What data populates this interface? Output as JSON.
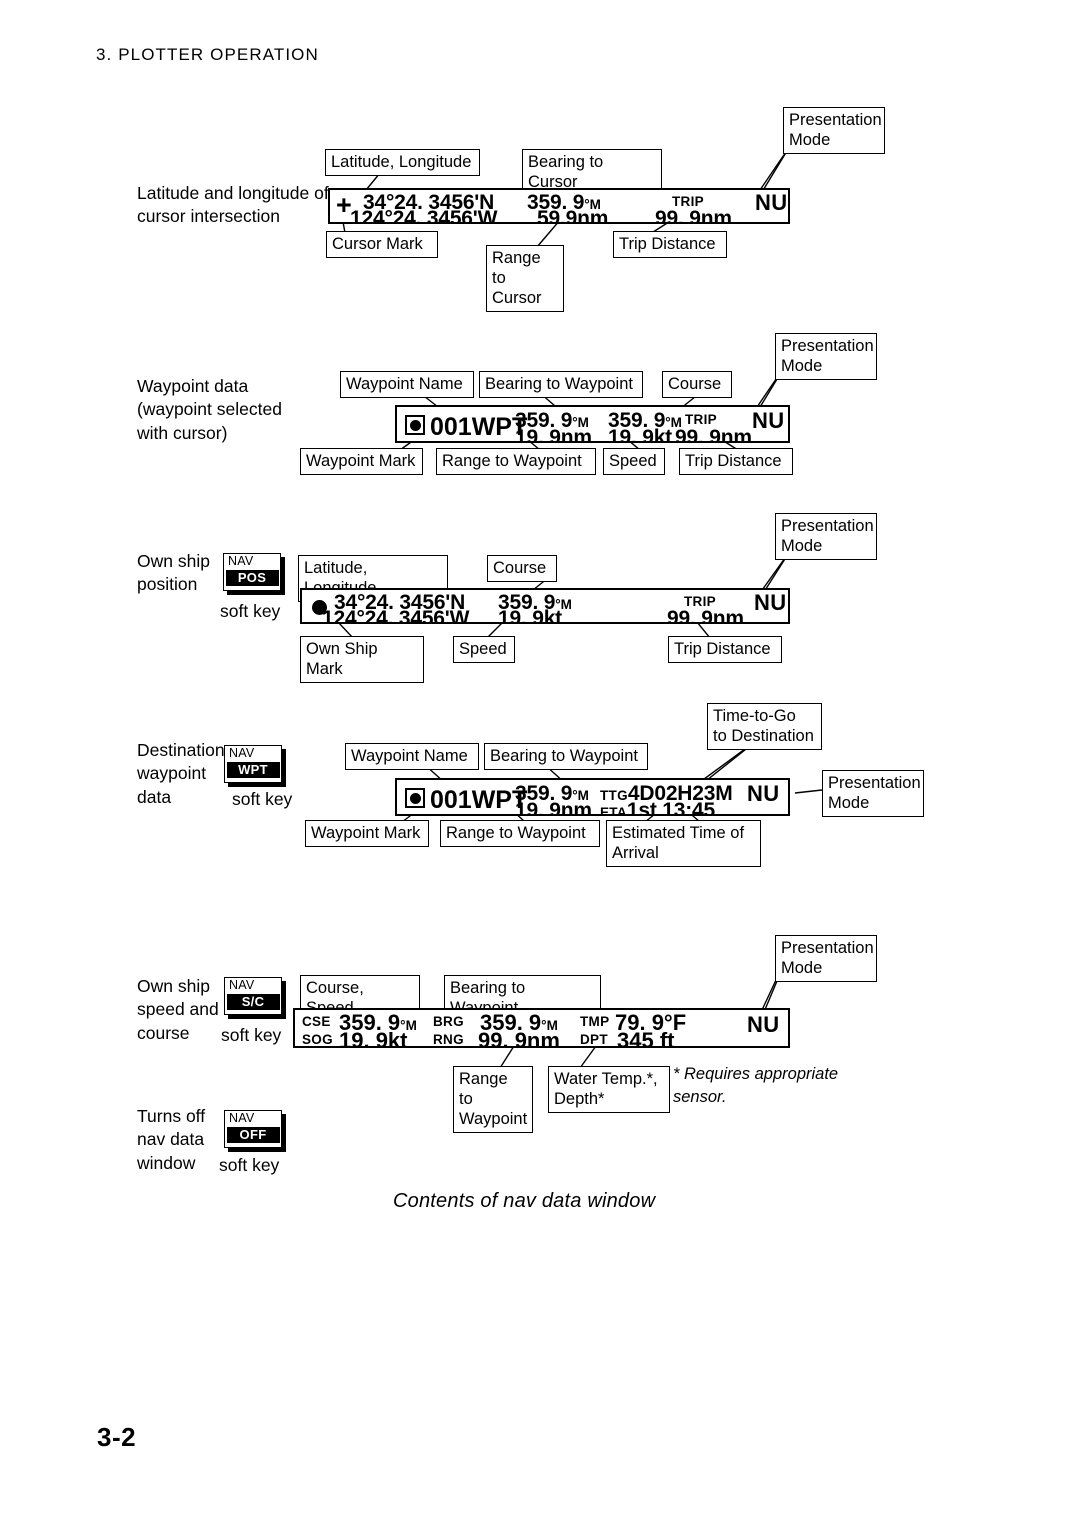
{
  "document": {
    "chapter_head": "3. PLOTTER OPERATION",
    "page_number": "3-2",
    "figure_caption": "Contents of nav data window",
    "footnote": "* Requires appropriate sensor."
  },
  "sections": {
    "cursor": {
      "description": "Latitude and longitude\nof cursor intersection",
      "window": {
        "cursor_mark": "+",
        "latitude": "34°24. 3456'N",
        "longitude": "124°24. 3456'W",
        "bearing": "359. 9",
        "bearing_unit": "°M",
        "range": "59.9nm",
        "trip_label": "TRIP",
        "trip_distance": "99. 9nm",
        "mode": "NU"
      },
      "callouts": {
        "lat_lon": "Latitude, Longitude",
        "bearing_to_cursor": "Bearing to Cursor",
        "presentation_mode": "Presentation\nMode",
        "cursor_mark": "Cursor Mark",
        "range_to_cursor": "Range to\nCursor",
        "trip_distance": "Trip Distance"
      }
    },
    "waypoint_cursor": {
      "description": "Waypoint data\n(waypoint selected\nwith cursor)",
      "window": {
        "waypoint_name": "001WPT",
        "bearing": "359. 9",
        "bearing_unit": "°M",
        "range": "19. 9nm",
        "course": "359. 9",
        "course_unit": "°M",
        "speed": "19. 9kt",
        "trip_label": "TRIP",
        "trip_distance": "99. 9nm",
        "mode": "NU"
      },
      "callouts": {
        "waypoint_name": "Waypoint Name",
        "bearing_to_waypoint": "Bearing to Waypoint",
        "course": "Course",
        "presentation_mode": "Presentation\nMode",
        "waypoint_mark": "Waypoint Mark",
        "range_to_waypoint": "Range to Waypoint",
        "speed": "Speed",
        "trip_distance": "Trip Distance"
      }
    },
    "own_ship_position": {
      "description": "Own ship\nposition",
      "softkey": {
        "top": "NAV",
        "label": "POS",
        "caption": "soft key"
      },
      "window": {
        "latitude": "34°24. 3456'N",
        "longitude": "124°24. 3456'W",
        "course": "359. 9",
        "course_unit": "°M",
        "speed": "19. 9kt",
        "trip_label": "TRIP",
        "trip_distance": "99. 9nm",
        "mode": "NU"
      },
      "callouts": {
        "lat_lon": "Latitude, Longitude",
        "course": "Course",
        "presentation_mode": "Presentation\nMode",
        "own_ship_mark": "Own Ship Mark",
        "speed": "Speed",
        "trip_distance": "Trip Distance"
      }
    },
    "destination_waypoint": {
      "description": "Destination\nwaypoint\ndata",
      "softkey": {
        "top": "NAV",
        "label": "WPT",
        "caption": "soft key"
      },
      "window": {
        "waypoint_name": "001WPT",
        "bearing": "359. 9",
        "bearing_unit": "°M",
        "range": "19. 9nm",
        "ttg_label": "TTG",
        "ttg_value": "4D02H23M",
        "eta_label": "ETA",
        "eta_value": "1st 13:45",
        "mode": "NU"
      },
      "callouts": {
        "waypoint_name": "Waypoint Name",
        "bearing_to_waypoint": "Bearing to Waypoint",
        "time_to_go": "Time-to-Go\nto Destination",
        "presentation_mode": "Presentation\nMode",
        "waypoint_mark": "Waypoint Mark",
        "range_to_waypoint": "Range to Waypoint",
        "eta": "Estimated Time of\nArrival"
      }
    },
    "speed_course": {
      "description": "Own ship\nspeed and\ncourse",
      "softkey": {
        "top": "NAV",
        "label": "S/C",
        "caption": "soft key"
      },
      "window": {
        "cse_label": "CSE",
        "cse_value": "359. 9",
        "cse_unit": "°M",
        "sog_label": "SOG",
        "sog_value": "19. 9kt",
        "brg_label": "BRG",
        "brg_value": "359. 9",
        "brg_unit": "°M",
        "rng_label": "RNG",
        "rng_value": "99. 9nm",
        "tmp_label": "TMP",
        "tmp_value": "79. 9°F",
        "dpt_label": "DPT",
        "dpt_value": "345 ft",
        "mode": "NU"
      },
      "callouts": {
        "course_speed": "Course, Speed",
        "bearing_to_waypoint": "Bearing to Waypoint",
        "presentation_mode": "Presentation\nMode",
        "range_to_waypoint": "Range\nto\nWaypoint",
        "water_temp_depth": "Water Temp.*,\nDepth*"
      }
    },
    "nav_off": {
      "description": "Turns off\nnav data\nwindow",
      "softkey": {
        "top": "NAV",
        "label": "OFF",
        "caption": "soft key"
      }
    }
  }
}
